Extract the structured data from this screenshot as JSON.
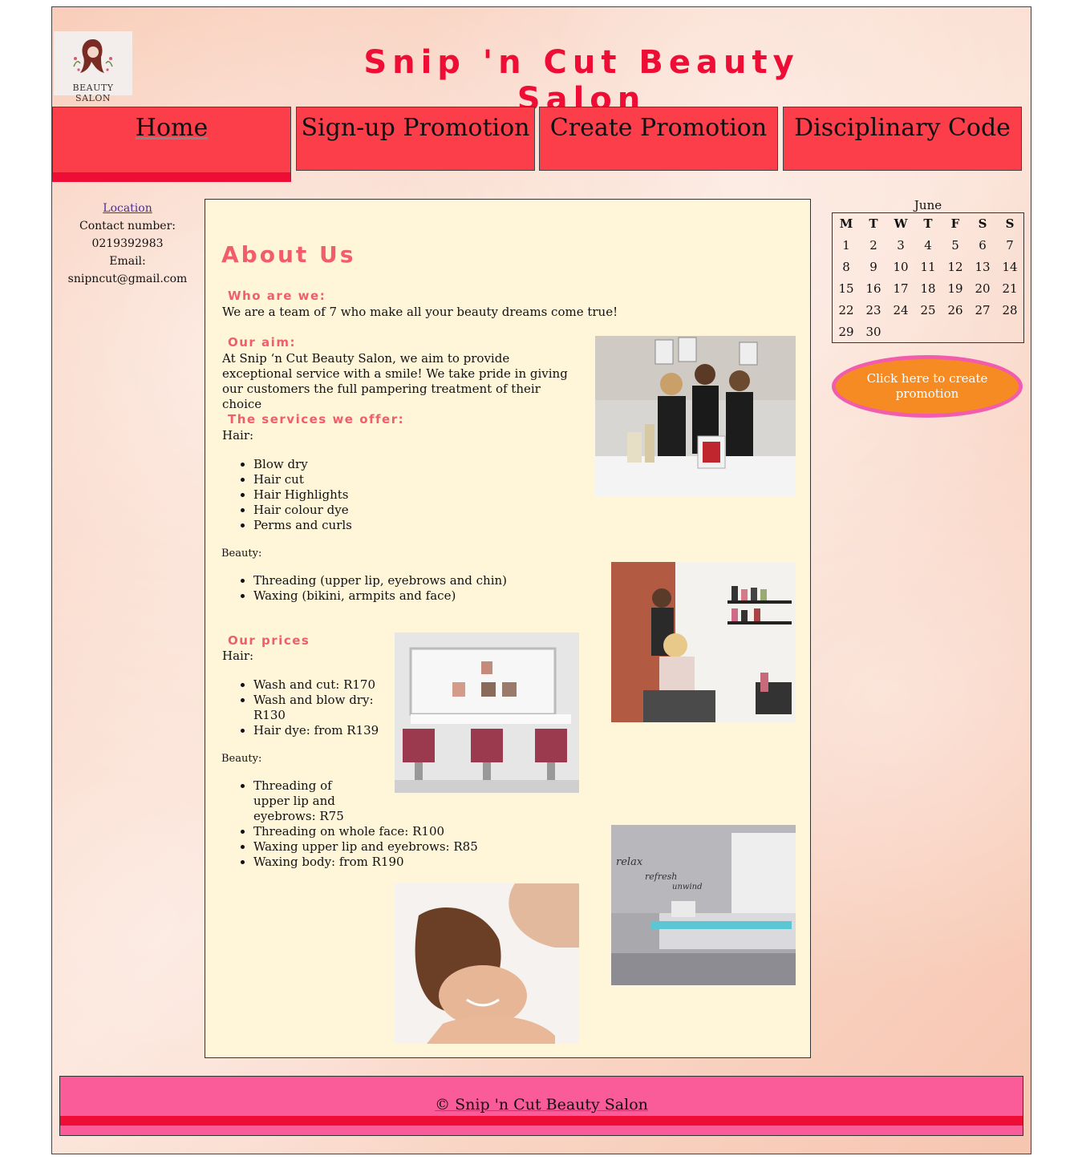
{
  "header": {
    "logo_text": "BEAUTY SALON",
    "title": "Snip 'n Cut Beauty Salon"
  },
  "nav": {
    "items": [
      {
        "label": "Home"
      },
      {
        "label": "Sign-up Promotion"
      },
      {
        "label": "Create Promotion"
      },
      {
        "label": "Disciplinary Code"
      }
    ]
  },
  "contact": {
    "location_link": "Location",
    "phone_label": "Contact number:",
    "phone": "0219392983",
    "email_label": "Email:",
    "email": "snipncut@gmail.com"
  },
  "about": {
    "title": "About Us",
    "who_heading": "Who are we:",
    "who_text": "We are a team of 7 who make all your beauty dreams come true!",
    "aim_heading": "Our aim:",
    "aim_text": "At Snip ‘n Cut Beauty Salon, we aim to provide exceptional service with a smile! We take pride in giving our customers the full pampering treatment of their choice",
    "services_heading": "The services we offer:",
    "services_hair_label": "Hair:",
    "services_hair": [
      "Blow dry",
      "Hair cut",
      "Hair Highlights",
      "Hair colour dye",
      "Perms and curls"
    ],
    "services_beauty_label": "Beauty:",
    "services_beauty": [
      "Threading (upper lip, eyebrows and chin)",
      "Waxing (bikini, armpits and face)"
    ],
    "prices_heading": "Our prices",
    "prices_hair_label": "Hair:",
    "prices_hair": [
      "Wash and cut: R170",
      "Wash and blow dry: R130",
      "Hair dye: from R139"
    ],
    "prices_beauty_label": "Beauty:",
    "prices_beauty": [
      "Threading of upper lip and eyebrows: R75",
      "Threading on whole face: R100",
      "Waxing upper lip and eyebrows: R85",
      "Waxing body: from R190"
    ],
    "wall_text": [
      "relax",
      "refresh",
      "unwind"
    ]
  },
  "calendar": {
    "month": "June",
    "weekdays": [
      "M",
      "T",
      "W",
      "T",
      "F",
      "S",
      "S"
    ],
    "weeks": [
      [
        "1",
        "2",
        "3",
        "4",
        "5",
        "6",
        "7"
      ],
      [
        "8",
        "9",
        "10",
        "11",
        "12",
        "13",
        "14"
      ],
      [
        "15",
        "16",
        "17",
        "18",
        "19",
        "20",
        "21"
      ],
      [
        "22",
        "23",
        "24",
        "25",
        "26",
        "27",
        "28"
      ],
      [
        "29",
        "30",
        "",
        "",
        "",
        "",
        ""
      ]
    ]
  },
  "cta": {
    "label": "Click here to create promotion"
  },
  "footer": {
    "copyright": "© Snip 'n Cut Beauty Salon"
  },
  "colors": {
    "title_red": "#ee0e35",
    "nav_red": "#fc3d4a",
    "heading_coral": "#f05d6b",
    "content_bg": "#fff5d9",
    "cta_orange": "#f68b24",
    "cta_border_pink": "#f25cad",
    "footer_pink": "#fa5c99"
  }
}
